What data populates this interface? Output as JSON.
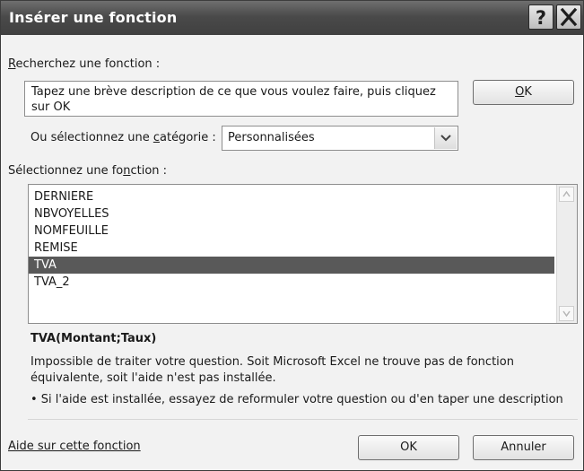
{
  "window": {
    "title": "Insérer une fonction"
  },
  "search": {
    "label_key": "R",
    "label_rest": "echerchez une fonction :",
    "description": "Tapez une brève description de ce que vous voulez faire, puis cliquez sur OK",
    "go_key": "O",
    "go_rest": "K"
  },
  "category": {
    "label_before": "Ou sélectionnez une ",
    "label_key": "c",
    "label_after": "atégorie :",
    "selected": "Personnalisées"
  },
  "function_list": {
    "label_before": "Sélectionnez une fo",
    "label_key": "n",
    "label_after": "ction :",
    "items": [
      "DERNIERE",
      "NBVOYELLES",
      "NOMFEUILLE",
      "REMISE",
      "TVA",
      "TVA_2"
    ],
    "selected_index": 4
  },
  "detail": {
    "signature": "TVA(Montant;Taux)",
    "message_line1": "Impossible de traiter votre question. Soit Microsoft Excel ne trouve pas de fonction",
    "message_line2": "équivalente, soit l'aide n'est pas installée.",
    "tip": "• Si l'aide est installée, essayez de reformuler votre question ou d'en taper une description"
  },
  "footer": {
    "help_link": "Aide sur cette fonction",
    "ok": "OK",
    "cancel": "Annuler"
  },
  "icons": {
    "help": "question-mark-icon",
    "close": "close-x-icon",
    "dropdown": "chevron-down-icon",
    "scroll_up": "triangle-up-icon",
    "scroll_down": "triangle-down-icon"
  },
  "colors": {
    "titlebar": "#4a4a4a",
    "selection": "#595959",
    "dialog_bg": "#f2f2f2"
  }
}
